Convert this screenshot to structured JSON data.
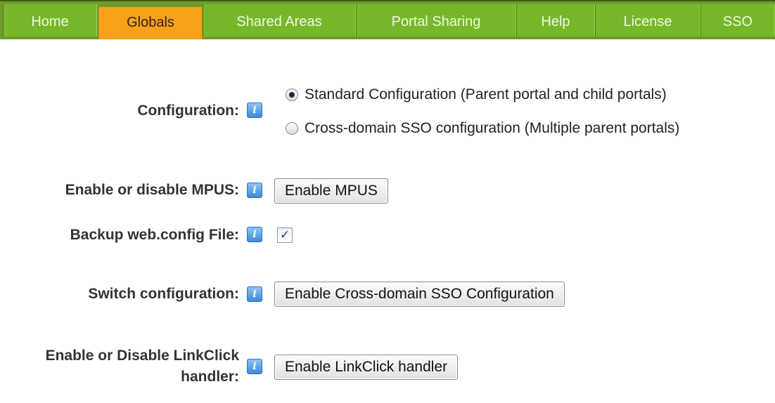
{
  "tabs": [
    {
      "label": "Home"
    },
    {
      "label": "Globals",
      "active": true
    },
    {
      "label": "Shared Areas"
    },
    {
      "label": "Portal Sharing"
    },
    {
      "label": "Help"
    },
    {
      "label": "License"
    },
    {
      "label": "SSO"
    }
  ],
  "colors": {
    "tabbar": "#6f9b2c",
    "tab": "#77b82b",
    "active_tab": "#f7a11a",
    "help_icon": "#3e8ad7"
  },
  "icons": {
    "help": "info-help-icon"
  },
  "help_glyph": "i",
  "configuration": {
    "label": "Configuration:",
    "options": [
      {
        "label": "Standard Configuration (Parent portal and child portals)",
        "selected": true
      },
      {
        "label": "Cross-domain SSO configuration (Multiple parent portals)",
        "selected": false
      }
    ]
  },
  "mpus": {
    "label": "Enable or disable MPUS:",
    "button": "Enable MPUS"
  },
  "backup": {
    "label": "Backup web.config File:",
    "checked": true,
    "check_glyph": "✓"
  },
  "switch": {
    "label": "Switch configuration:",
    "button": "Enable Cross-domain SSO Configuration"
  },
  "linkclick": {
    "label_line1": "Enable or Disable LinkClick",
    "label_line2": "handler:",
    "button": "Enable LinkClick handler"
  }
}
